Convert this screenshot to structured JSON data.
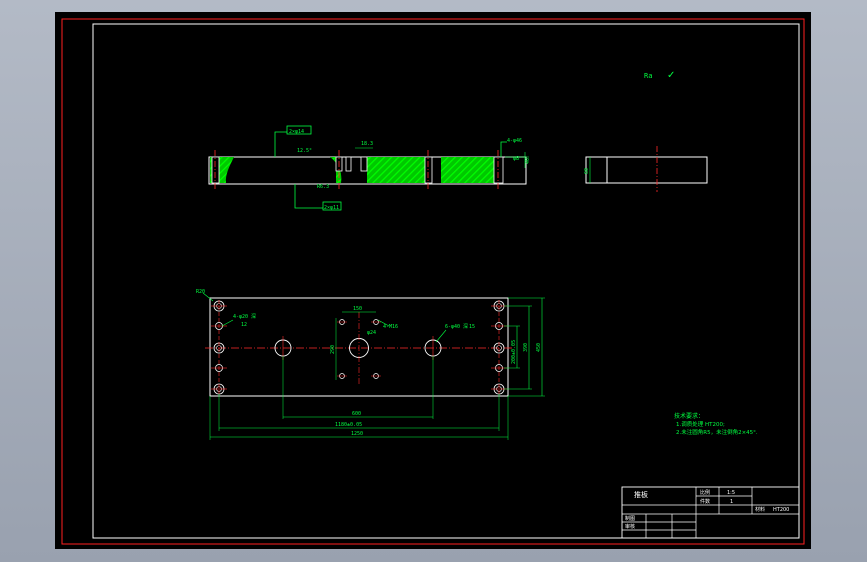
{
  "colors": {
    "frame_red": "#ff2020",
    "outline_white": "#ffffff",
    "dimension_green": "#00ff40",
    "center_red": "#ff2a2a",
    "hatch_green": "#00ff00"
  },
  "roughness": {
    "mark": "Ra",
    "check_glyph": "✓"
  },
  "front_view": {
    "callout_top": "2×φ14",
    "angle_label": "12.5°",
    "slot_label": "18.3",
    "hole_callout": "4-φ46",
    "depth_label": "φ8",
    "radius_label": "R6.3",
    "callout_bottom": "2×φ11",
    "right_label": "40"
  },
  "side_view": {
    "height_label": "60"
  },
  "plan_view": {
    "corner_label": "R20",
    "left_callout": "4-φ20 深",
    "left_callout_sub": "12",
    "top_dim": "150",
    "center_callout": "4-M16",
    "center_dia": "φ24",
    "right_callout": "6-φ40 深",
    "right_callout_sub": "15",
    "left_vertical_dim": "290",
    "right_dim_1": "200±0.05",
    "right_dim_2": "390",
    "right_dim_3": "450",
    "bottom_dim_1": "600",
    "bottom_dim_2": "1180±0.05",
    "bottom_dim_3": "1250"
  },
  "notes": {
    "title": "技术要求：",
    "line1": "1.调质处理 HT200;",
    "line2": "2.未注圆角R5，未注倒角2×45°."
  },
  "title_block": {
    "part_name": "推板",
    "ratio_label": "比例",
    "ratio_value": "1:5",
    "qty_label": "件数",
    "qty_value": "1",
    "material_label": "材料",
    "material_value": "HT200",
    "drawn_label": "制图",
    "checked_label": "审核"
  }
}
